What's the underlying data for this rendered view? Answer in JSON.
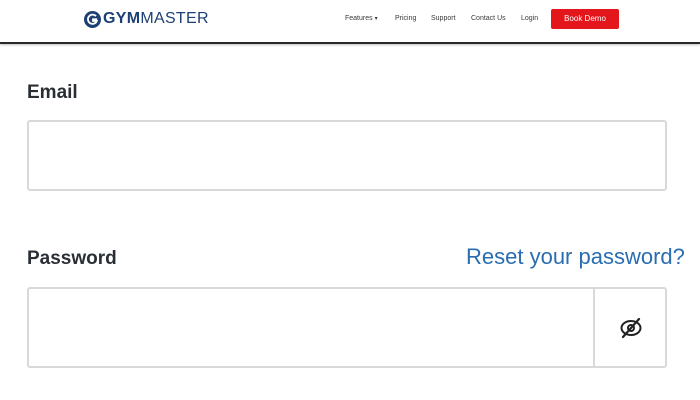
{
  "header": {
    "logo_text_bold": "GYM",
    "logo_text_light": "MASTER",
    "nav": [
      {
        "label": "Features",
        "has_dropdown": true
      },
      {
        "label": "Pricing"
      },
      {
        "label": "Support"
      },
      {
        "label": "Contact Us"
      },
      {
        "label": "Login"
      }
    ],
    "cta_label": "Book Demo",
    "cta_color": "#e3161b"
  },
  "form": {
    "email_label": "Email",
    "email_value": "",
    "password_label": "Password",
    "password_value": "",
    "reset_link": "Reset your password?",
    "toggle_icon": "eye-off-icon"
  },
  "colors": {
    "brand": "#1e3f74",
    "link": "#2a6db0"
  }
}
